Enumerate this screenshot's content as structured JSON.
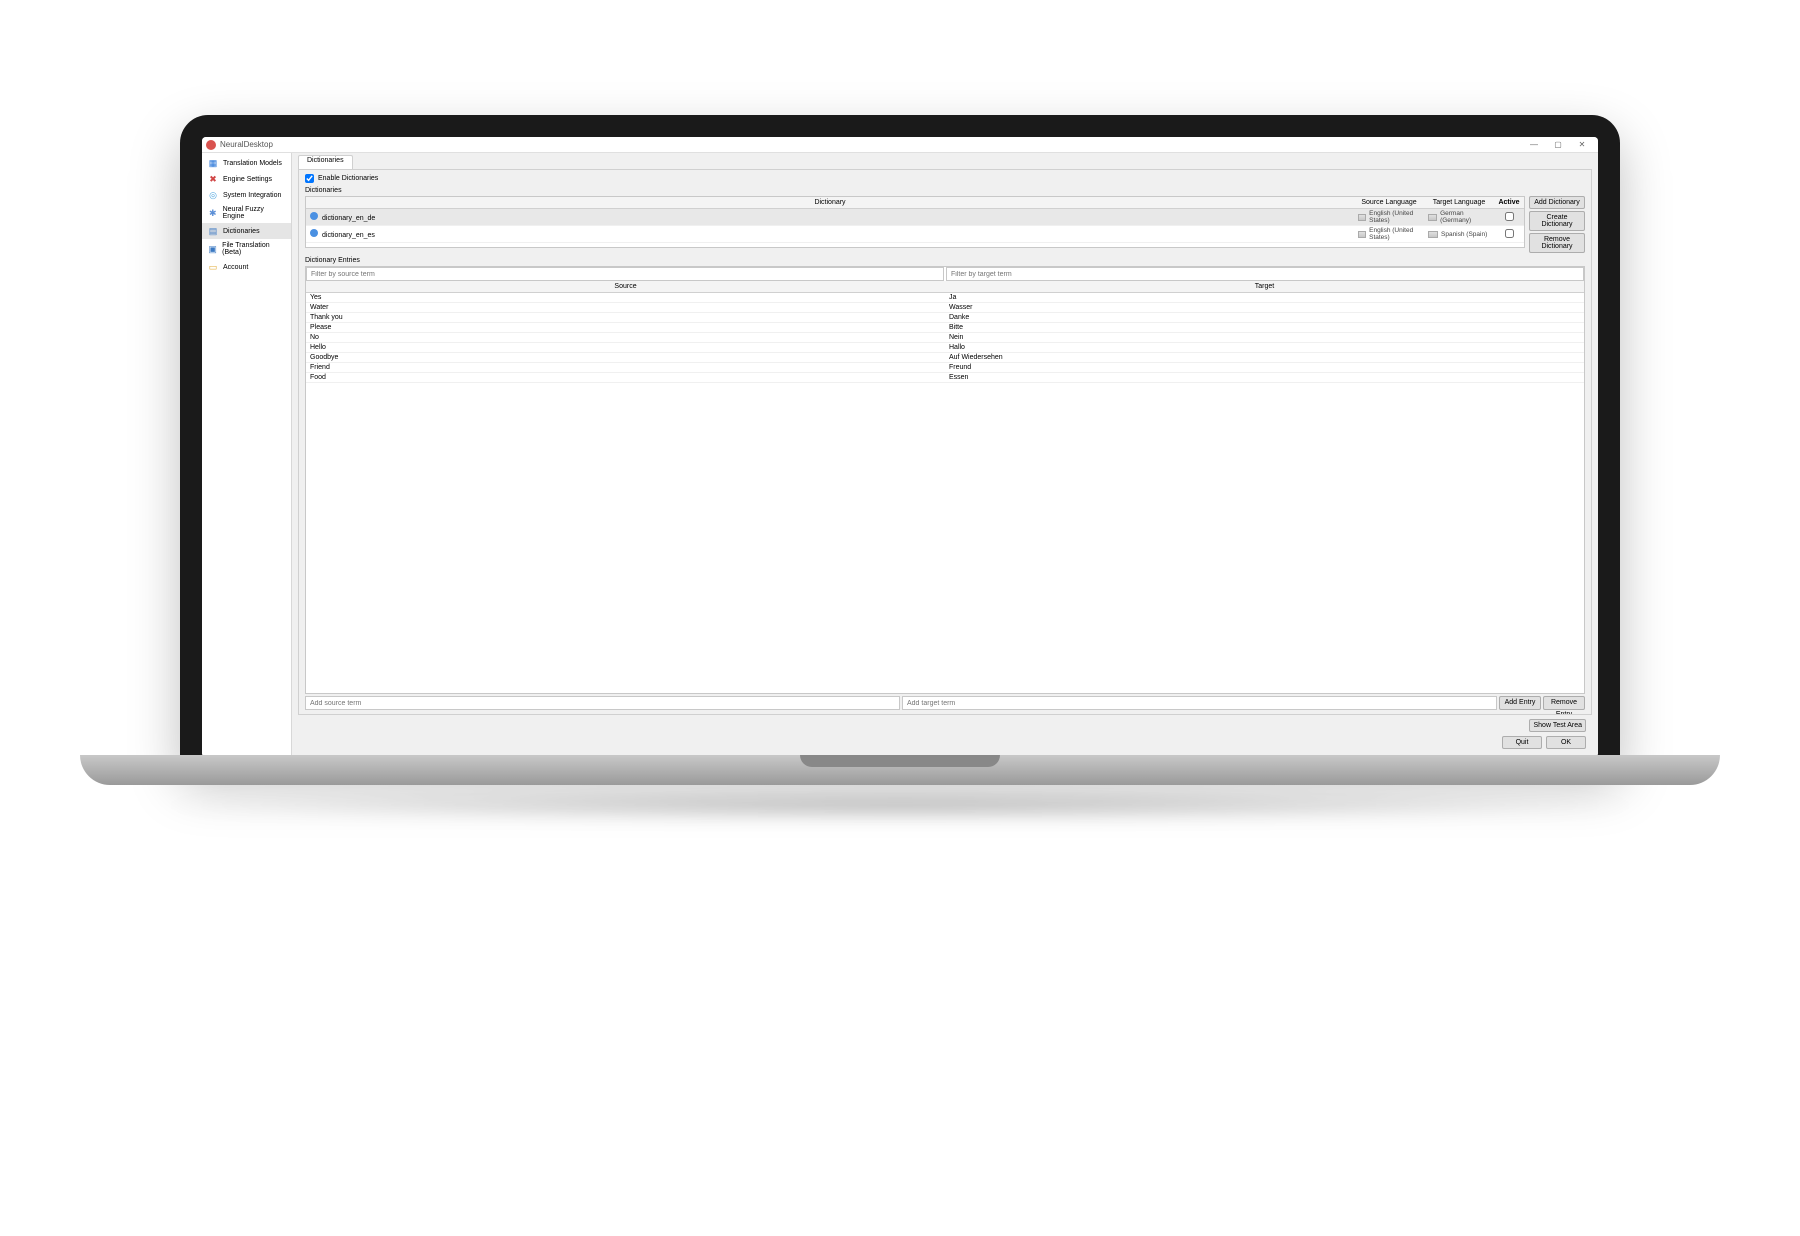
{
  "app": {
    "title": "NeuralDesktop"
  },
  "window_controls": {
    "minimize": "—",
    "maximize": "▢",
    "close": "✕"
  },
  "sidebar": {
    "items": [
      {
        "label": "Translation Models",
        "icon_color": "#1e6fd6"
      },
      {
        "label": "Engine Settings",
        "icon_color": "#d04545"
      },
      {
        "label": "System Integration",
        "icon_color": "#4aa3df"
      },
      {
        "label": "Neural Fuzzy Engine",
        "icon_color": "#5c8fd6"
      },
      {
        "label": "Dictionaries",
        "icon_color": "#3a78c2"
      },
      {
        "label": "File Translation (Beta)",
        "icon_color": "#3a78c2"
      },
      {
        "label": "Account",
        "icon_color": "#e0a830"
      }
    ],
    "active_index": 4
  },
  "tabs": {
    "dictionaries": "Dictionaries"
  },
  "enable_row": {
    "label": "Enable Dictionaries",
    "checked": true
  },
  "dict_section": {
    "label": "Dictionaries",
    "headers": {
      "name": "Dictionary",
      "source": "Source Language",
      "target": "Target Language",
      "active": "Active"
    },
    "rows": [
      {
        "name": "dictionary_en_de",
        "source": "English (United States)",
        "target": "German (Germany)",
        "active": false,
        "selected": true
      },
      {
        "name": "dictionary_en_es",
        "source": "English (United States)",
        "target": "Spanish (Spain)",
        "active": false,
        "selected": false
      }
    ],
    "buttons": {
      "add": "Add Dictionary",
      "create": "Create Dictionary",
      "remove": "Remove Dictionary"
    }
  },
  "entries_section": {
    "label": "Dictionary Entries",
    "filter_source_ph": "Filter by source term",
    "filter_target_ph": "Filter by target term",
    "headers": {
      "source": "Source",
      "target": "Target"
    },
    "rows": [
      {
        "s": "Yes",
        "t": "Ja"
      },
      {
        "s": "Water",
        "t": "Wasser"
      },
      {
        "s": "Thank you",
        "t": "Danke"
      },
      {
        "s": "Please",
        "t": "Bitte"
      },
      {
        "s": "No",
        "t": "Nein"
      },
      {
        "s": "Hello",
        "t": "Hallo"
      },
      {
        "s": "Goodbye",
        "t": "Auf Wiedersehen"
      },
      {
        "s": "Friend",
        "t": "Freund"
      },
      {
        "s": "Food",
        "t": "Essen"
      }
    ],
    "add_source_ph": "Add source term",
    "add_target_ph": "Add target term",
    "add_btn": "Add Entry",
    "remove_btn": "Remove Entry"
  },
  "footer": {
    "show_test": "Show Test Area",
    "quit": "Quit",
    "ok": "OK"
  }
}
